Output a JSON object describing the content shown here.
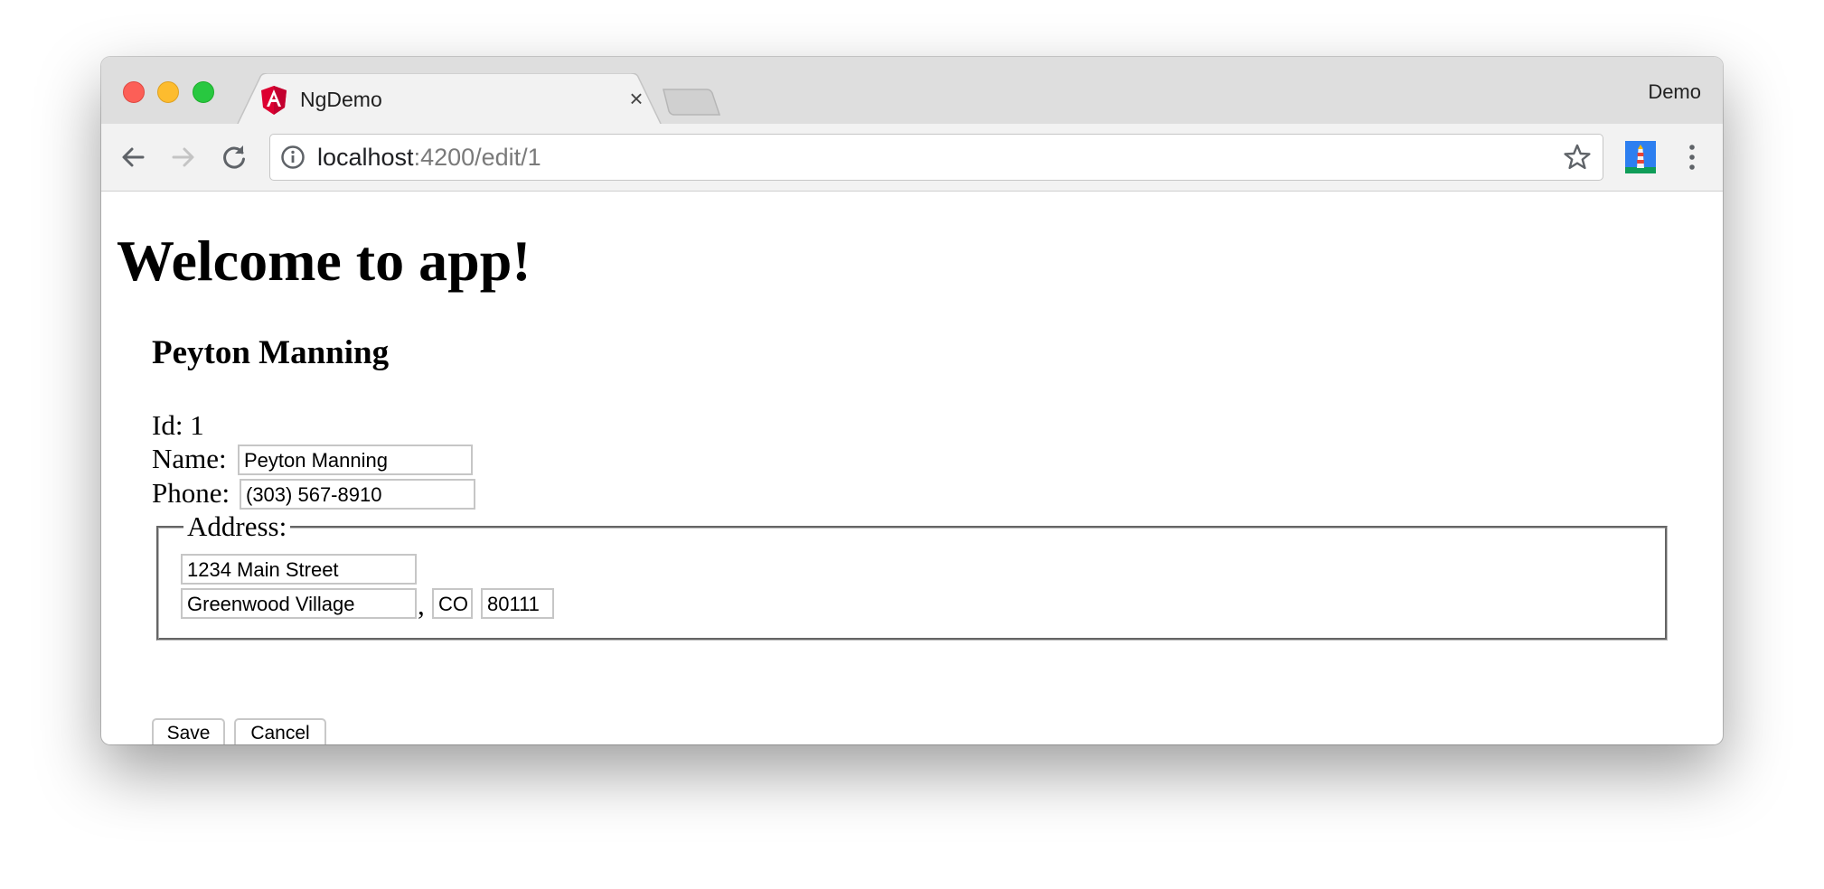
{
  "browser": {
    "tab_title": "NgDemo",
    "tab_close_glyph": "×",
    "profile_name": "Demo",
    "url_host": "localhost",
    "url_path": ":4200/edit/1"
  },
  "page": {
    "heading": "Welcome to app!",
    "person_name": "Peyton Manning",
    "id_label": "Id:",
    "id_value": "1",
    "name_label": "Name:",
    "name_value": "Peyton Manning",
    "phone_label": "Phone:",
    "phone_value": "(303) 567-8910",
    "address_legend": "Address:",
    "street_value": "1234 Main Street",
    "city_value": "Greenwood Village",
    "comma": ",",
    "state_value": "CO",
    "zip_value": "80111",
    "save_label": "Save",
    "cancel_label": "Cancel"
  },
  "icons": {
    "tab_icon": "angular-logo-icon",
    "back": "back-arrow-icon",
    "forward": "forward-arrow-icon",
    "reload": "reload-icon",
    "info": "info-icon",
    "bookmark": "star-icon",
    "extension": "lighthouse-extension-icon",
    "menu": "kebab-menu-icon"
  },
  "colors": {
    "angular_red": "#dd0031",
    "close_light": "#fc5f57",
    "minimize_light": "#fdbc2e",
    "zoom_light": "#28c840"
  }
}
